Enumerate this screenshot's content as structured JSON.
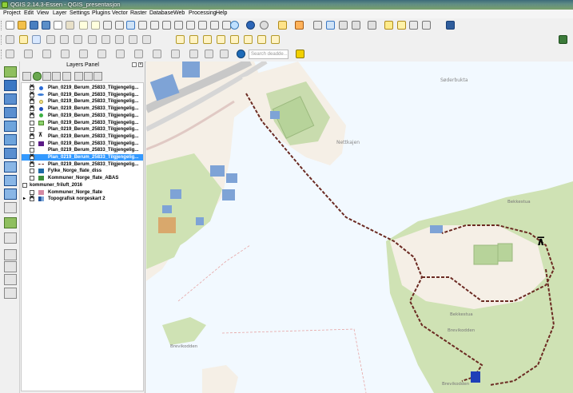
{
  "window": {
    "title": "QGIS 2.14.3-Essen - QGIS_presentasjon"
  },
  "menu": [
    "Project",
    "Edit",
    "View",
    "Layer",
    "Settings",
    "Plugins",
    "Vector",
    "Raster",
    "Database",
    "Web",
    "Processing",
    "Help"
  ],
  "toolbar": {
    "search_placeholder": "Search deadde..."
  },
  "layers_panel": {
    "title": "Layers Panel",
    "layers": [
      {
        "label": "Plan_0219_Berum_25833_Tilgjengelig...",
        "checked": true,
        "symbol": "blue-dot"
      },
      {
        "label": "Plan_0219_Berum_25833_Tilgjengelig...",
        "checked": true,
        "symbol": "blue-fish"
      },
      {
        "label": "Plan_0219_Berum_25833_Tilgjengelig...",
        "checked": true,
        "symbol": "yellow-dot"
      },
      {
        "label": "Plan_0219_Berum_25833_Tilgjengelig...",
        "checked": true,
        "symbol": "blue-dot"
      },
      {
        "label": "Plan_0219_Berum_25833_Tilgjengelig...",
        "checked": true,
        "symbol": "green-dot"
      },
      {
        "label": "Plan_0219_Berum_25833_Tilgjengelig...",
        "checked": false,
        "symbol": "green-square"
      },
      {
        "label": "Plan_0219_Berum_25833_Tilgjengelig...",
        "checked": false,
        "symbol": "none"
      },
      {
        "label": "Plan_0219_Berum_25833_Tilgjengelig...",
        "checked": true,
        "symbol": "picnic-table"
      },
      {
        "label": "Plan_0219_Berum_25833_Tilgjengelig...",
        "checked": false,
        "symbol": "purple-square"
      },
      {
        "label": "Plan_0219_Berum_25833_Tilgjengelig...",
        "checked": false,
        "symbol": "none"
      },
      {
        "label": "Plan_0219_Berum_25833_Tilgjengelig...",
        "checked": true,
        "symbol": "none",
        "selected": true
      },
      {
        "label": "Plan_0219_Berum_25833_Tilgjengelig...",
        "checked": true,
        "symbol": "dashed-line"
      },
      {
        "label": "Fylke_Norge_flate_diss",
        "checked": false,
        "symbol": "blue-square"
      },
      {
        "label": "Kommuner_Norge_flate_ABAS",
        "checked": false,
        "symbol": "green-square2"
      },
      {
        "label": "kommuner_friluft_2016",
        "checked": false,
        "symbol": "none"
      },
      {
        "label": "Kommuner_Norge_flate",
        "checked": false,
        "symbol": "pink-square"
      },
      {
        "label": "Topografisk norgeskart 2",
        "checked": true,
        "symbol": "raster-grid"
      }
    ]
  },
  "map": {
    "labels": [
      "Søderbukta",
      "Nettkajen",
      "Bekkestua",
      "Bekkestua",
      "Brevikodden",
      "Brevikodden",
      "Brevikodden"
    ],
    "colors": {
      "water": "#f2f9ff",
      "land": "#f5efe6",
      "forest": "#cfe2b4",
      "building": "#7ea3d6",
      "route": "#6b2a22"
    }
  }
}
